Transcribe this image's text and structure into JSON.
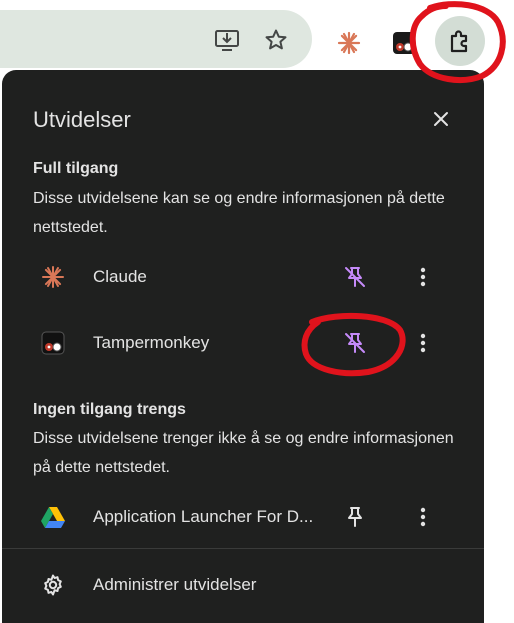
{
  "panel": {
    "title": "Utvidelser",
    "full_access": {
      "heading": "Full tilgang",
      "description": "Disse utvidelsene kan se og endre informasjonen på dette nettstedet.",
      "items": [
        {
          "name": "Claude",
          "icon": "claude-icon",
          "pin": "pin-off-icon"
        },
        {
          "name": "Tampermonkey",
          "icon": "tampermonkey-icon",
          "pin": "pin-off-icon"
        }
      ]
    },
    "no_access": {
      "heading": "Ingen tilgang trengs",
      "description": "Disse utvidelsene trenger ikke å se og endre informasjonen på dette nettstedet.",
      "items": [
        {
          "name": "Application Launcher For D...",
          "icon": "google-drive-icon",
          "pin": "pin-icon"
        }
      ]
    },
    "manage_label": "Administrer utvidelser"
  },
  "colors": {
    "panel_bg": "#1f201f",
    "text": "#e3e3e3",
    "pinned_accent": "#c58af9",
    "annotation": "#e0131c",
    "claude_orange": "#d97757"
  }
}
